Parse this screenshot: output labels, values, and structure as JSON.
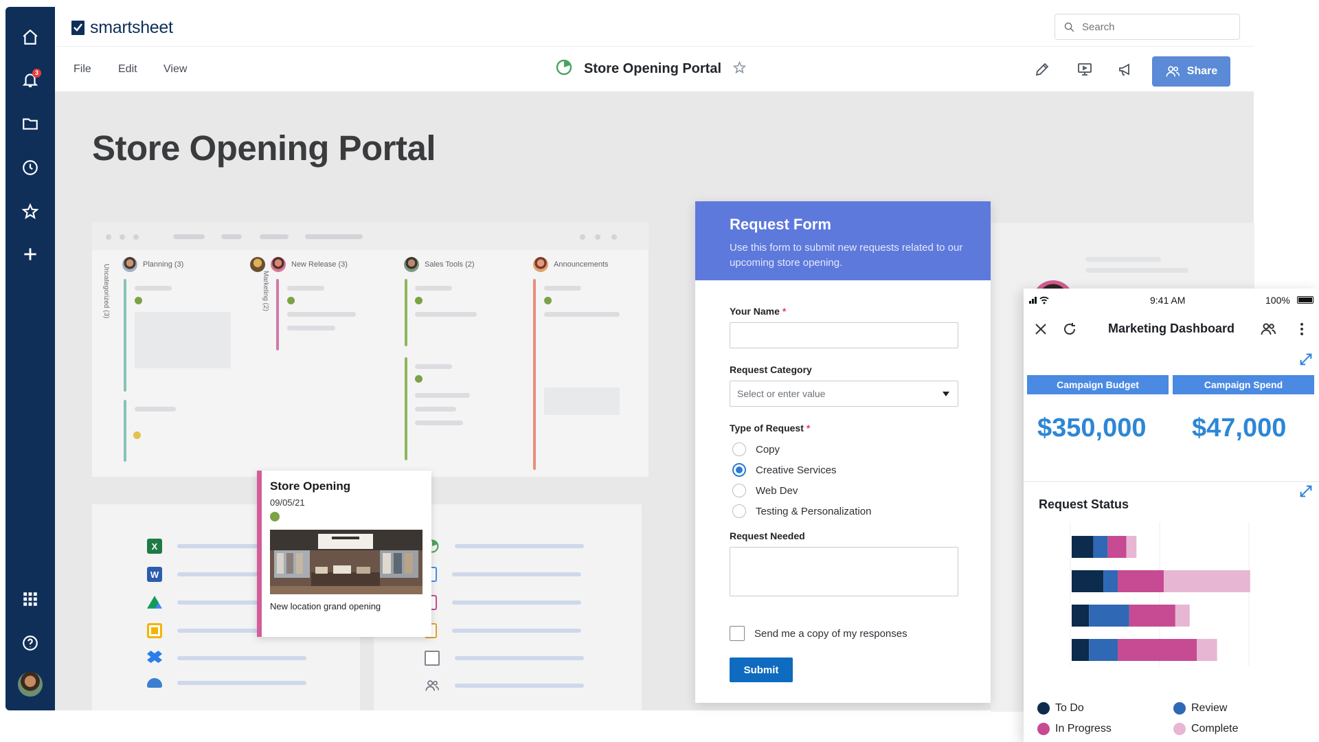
{
  "app": {
    "brand": "smartsheet"
  },
  "nav": {
    "notification_count": "3",
    "items": [
      "home-icon",
      "bell-icon",
      "folder-icon",
      "clock-icon",
      "star-icon",
      "plus-icon",
      "grid-icon",
      "help-icon"
    ]
  },
  "search": {
    "placeholder": "Search"
  },
  "menu": {
    "file": "File",
    "edit": "Edit",
    "view": "View"
  },
  "sheet": {
    "title": "Store Opening Portal"
  },
  "toolbar": {
    "share_label": "Share"
  },
  "page": {
    "title": "Store Opening Portal"
  },
  "board": {
    "columns": [
      {
        "label": "Planning (3)",
        "color": "#6fb4a6"
      },
      {
        "label": "New Release (3)",
        "color": "#c7649a"
      },
      {
        "label": "Sales Tools (2)",
        "color": "#7aa346"
      },
      {
        "label": "Announcements",
        "color": "#e07962"
      }
    ],
    "side_labels": [
      "Uncategorized (3)",
      "Marketing (2)"
    ]
  },
  "card": {
    "title": "Store Opening",
    "date": "09/05/21",
    "caption": "New location grand opening"
  },
  "form": {
    "title": "Request Form",
    "description": "Use this form to submit new requests related to our upcoming store opening.",
    "name_label": "Your Name",
    "required_mark": "*",
    "category_label": "Request Category",
    "category_placeholder": "Select or enter value",
    "type_label": "Type of Request",
    "options": [
      "Copy",
      "Creative Services",
      "Web Dev",
      "Testing & Personalization"
    ],
    "selected_option": "Creative Services",
    "needed_label": "Request Needed",
    "copy_label": "Send me a copy of my responses",
    "submit_label": "Submit"
  },
  "phone": {
    "time": "9:41 AM",
    "battery": "100%",
    "title": "Marketing Dashboard",
    "kpis": [
      {
        "label": "Campaign Budget",
        "value": "$350,000"
      },
      {
        "label": "Campaign Spend",
        "value": "$47,000"
      }
    ],
    "status_title": "Request Status"
  },
  "chart_data": {
    "type": "bar",
    "stacked": true,
    "orientation": "horizontal",
    "title": "Request Status",
    "categories": [
      "",
      "",
      "",
      ""
    ],
    "series": [
      {
        "name": "To Do",
        "color": "#0d2b4d",
        "values": [
          15,
          22,
          12,
          12
        ]
      },
      {
        "name": "Review",
        "color": "#2f68b4",
        "values": [
          10,
          10,
          28,
          20
        ]
      },
      {
        "name": "In Progress",
        "color": "#c64b92",
        "values": [
          13,
          32,
          32,
          55
        ]
      },
      {
        "name": "Complete",
        "color": "#e7b6d2",
        "values": [
          7,
          60,
          10,
          14
        ]
      }
    ],
    "xlim": [
      0,
      125
    ]
  },
  "legend_labels": [
    "To Do",
    "Review",
    "In Progress",
    "Complete"
  ],
  "colors": {
    "nav": "#0f2f59",
    "share": "#5b8ad6",
    "form_header": "#5d79dc",
    "submit": "#0e6bbf",
    "kpi": "#2d87d5"
  }
}
